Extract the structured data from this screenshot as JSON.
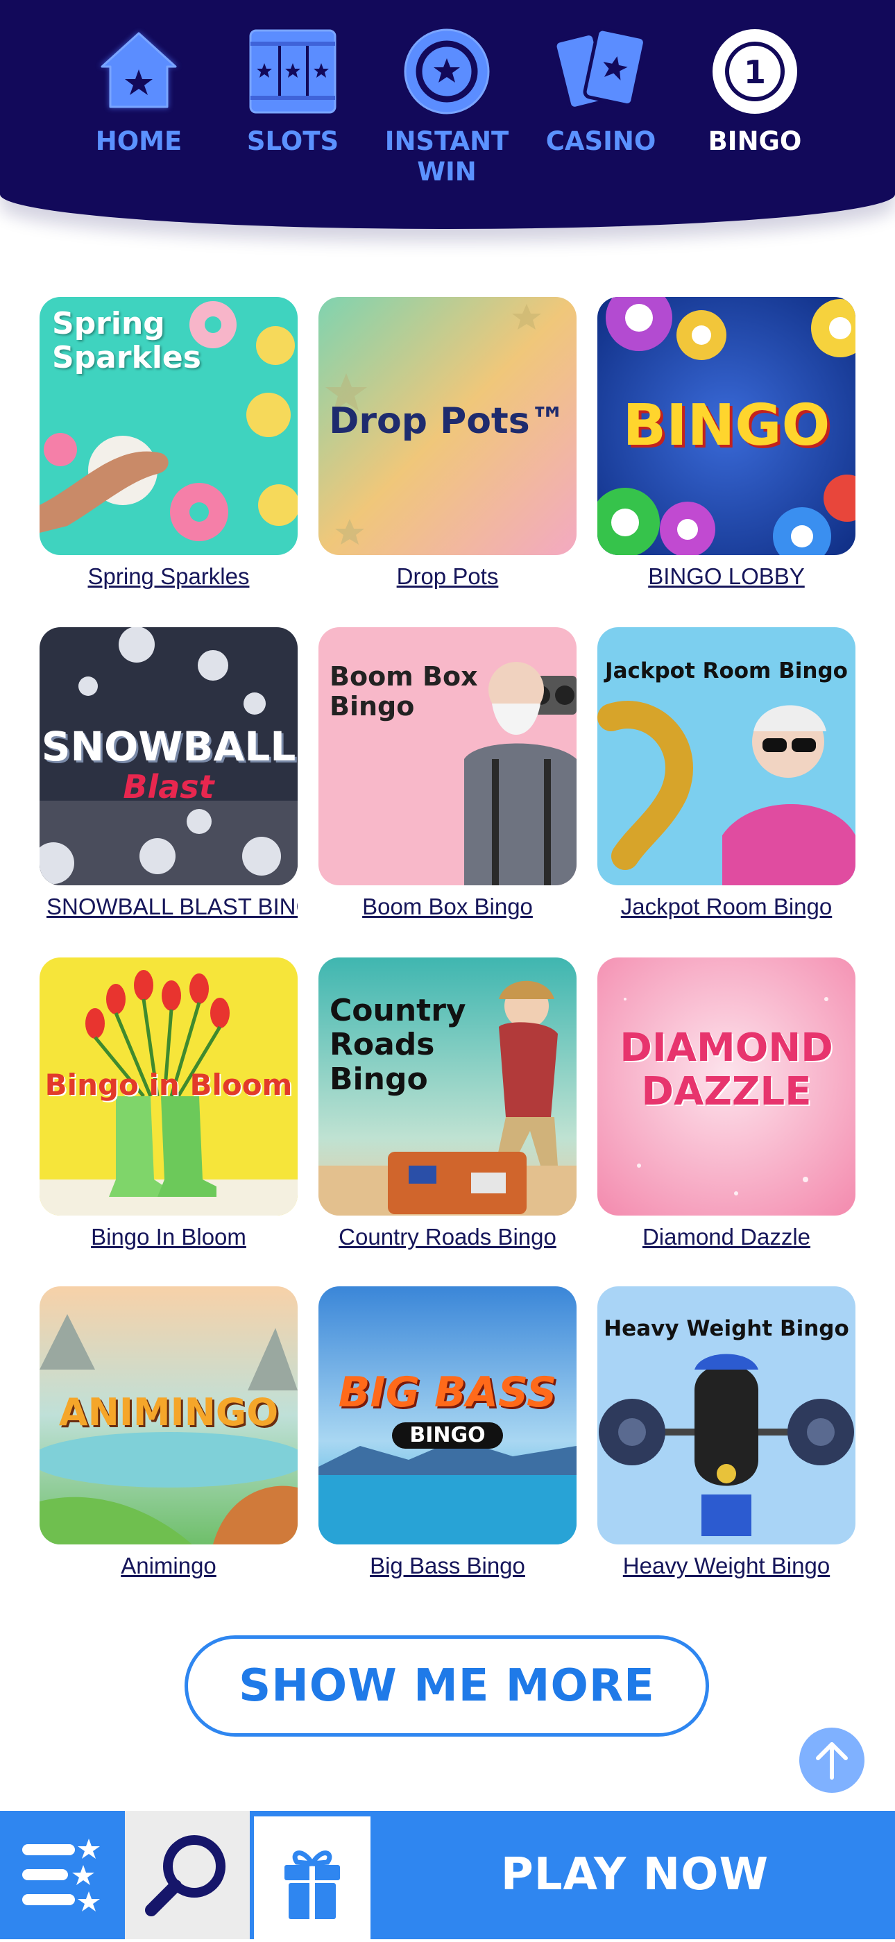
{
  "nav": {
    "items": [
      {
        "label": "HOME",
        "icon": "home-star-icon"
      },
      {
        "label": "SLOTS",
        "icon": "slot-reels-icon"
      },
      {
        "label": "INSTANT WIN",
        "icon": "star-coin-icon"
      },
      {
        "label": "CASINO",
        "icon": "playing-cards-icon"
      },
      {
        "label": "BINGO",
        "icon": "bingo-ball-icon"
      }
    ],
    "active": "BINGO",
    "bingo_ball_number": "1"
  },
  "games": [
    {
      "name": "Spring Sparkles",
      "thumb_title": "Spring\nSparkles"
    },
    {
      "name": "Drop Pots",
      "thumb_title": "Drop Pots™"
    },
    {
      "name": "BINGO LOBBY",
      "thumb_title": "BINGO"
    },
    {
      "name": "SNOWBALL BLAST BINGO",
      "thumb_title": "SNOWBALL",
      "thumb_subtitle": "Blast"
    },
    {
      "name": "Boom Box Bingo",
      "thumb_title": "Boom Box\nBingo"
    },
    {
      "name": "Jackpot Room Bingo",
      "thumb_title": "Jackpot Room Bingo"
    },
    {
      "name": "Bingo In Bloom",
      "thumb_title": "Bingo in Bloom"
    },
    {
      "name": "Country Roads Bingo",
      "thumb_title": "Country\nRoads\nBingo"
    },
    {
      "name": "Diamond Dazzle",
      "thumb_title": "DIAMOND\nDAZZLE"
    },
    {
      "name": "Animingo",
      "thumb_title": "ANIMINGO"
    },
    {
      "name": "Big Bass Bingo",
      "thumb_title": "BIG BASS",
      "thumb_subtitle": "BINGO"
    },
    {
      "name": "Heavy Weight Bingo",
      "thumb_title": "Heavy Weight Bingo"
    }
  ],
  "show_more_label": "SHOW ME MORE",
  "bottom_bar": {
    "menu_icon": "menu-stars-icon",
    "search_icon": "search-icon",
    "gift_icon": "gift-icon",
    "play_label": "PLAY NOW"
  },
  "colors": {
    "nav_bg": "#12095a",
    "nav_link": "#5b92ff",
    "accent": "#2f86f0",
    "link_text": "#16165a"
  }
}
